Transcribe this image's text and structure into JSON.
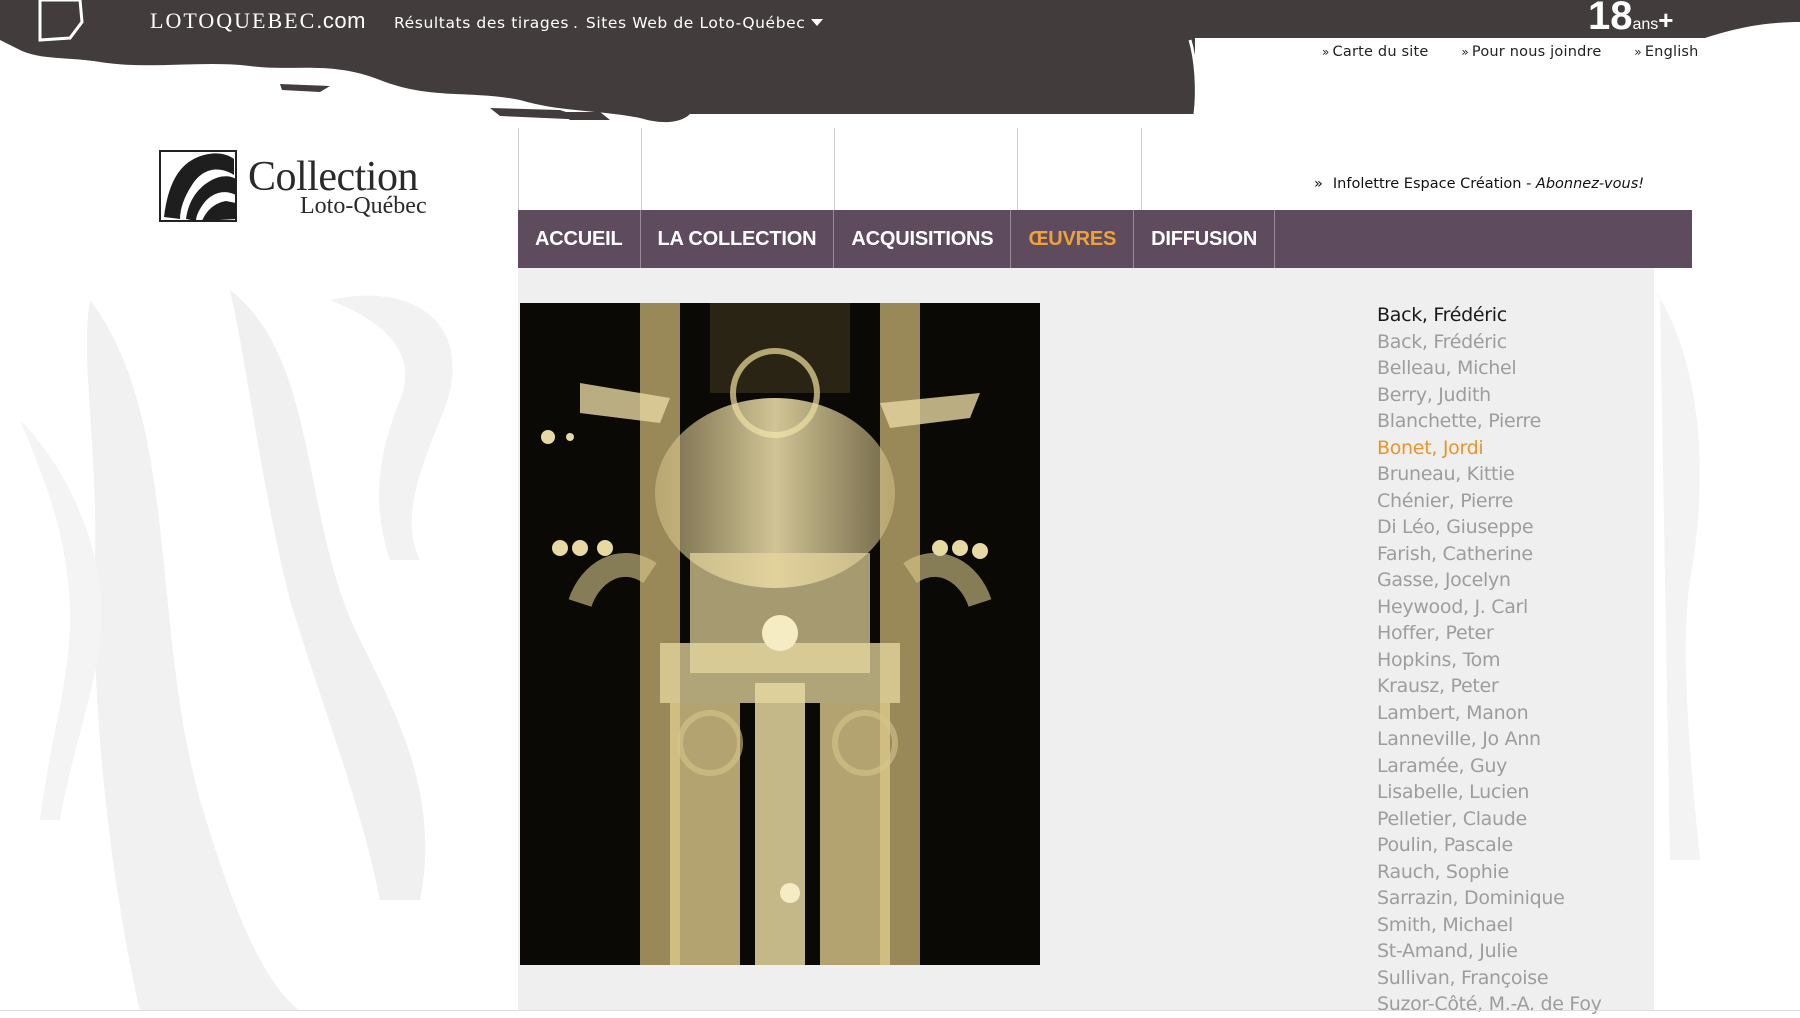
{
  "topbar": {
    "brand_main": "LOTOQUEBEC",
    "brand_suffix": ".com",
    "links": [
      "Résultats des tirages",
      "Sites Web de Loto-Québec"
    ],
    "separator": ".",
    "age_number": "18",
    "age_text": "ans",
    "age_plus": "+"
  },
  "utility_links": [
    "Carte du site",
    "Pour nous joindre",
    "English"
  ],
  "utility_prefix": "»",
  "logo": {
    "line1": "Collection",
    "line2": "Loto-Québec"
  },
  "newsletter": {
    "prefix": "»",
    "text": "Infolettre Espace Création - ",
    "cta": "Abonnez-vous!"
  },
  "nav": {
    "items": [
      "ACCUEIL",
      "LA COLLECTION",
      "ACQUISITIONS",
      "ŒUVRES",
      "DIFFUSION"
    ],
    "active": "ŒUVRES"
  },
  "artists": {
    "current": "Back, Frédéric",
    "selected": "Bonet, Jordi",
    "list": [
      "Back, Frédéric",
      "Belleau, Michel",
      "Berry, Judith",
      "Blanchette, Pierre",
      "Bonet, Jordi",
      "Bruneau, Kittie",
      "Chénier, Pierre",
      "Di Léo, Giuseppe",
      "Farish, Catherine",
      "Gasse, Jocelyn",
      "Heywood, J. Carl",
      "Hoffer, Peter",
      "Hopkins, Tom",
      "Krausz, Peter",
      "Lambert, Manon",
      "Lanneville, Jo Ann",
      "Laramée, Guy",
      "Lisabelle, Lucien",
      "Pelletier, Claude",
      "Poulin, Pascale",
      "Rauch, Sophie",
      "Sarrazin, Dominique",
      "Smith, Michael",
      "St-Amand, Julie",
      "Sullivan, Françoise",
      "Suzor-Côté, M.-A. de Foy"
    ]
  },
  "colors": {
    "topbar": "#443c3d",
    "nav": "#5e4b5d",
    "active": "#f0a23a",
    "selected": "#e8952a",
    "muted": "#9d9d9d"
  }
}
